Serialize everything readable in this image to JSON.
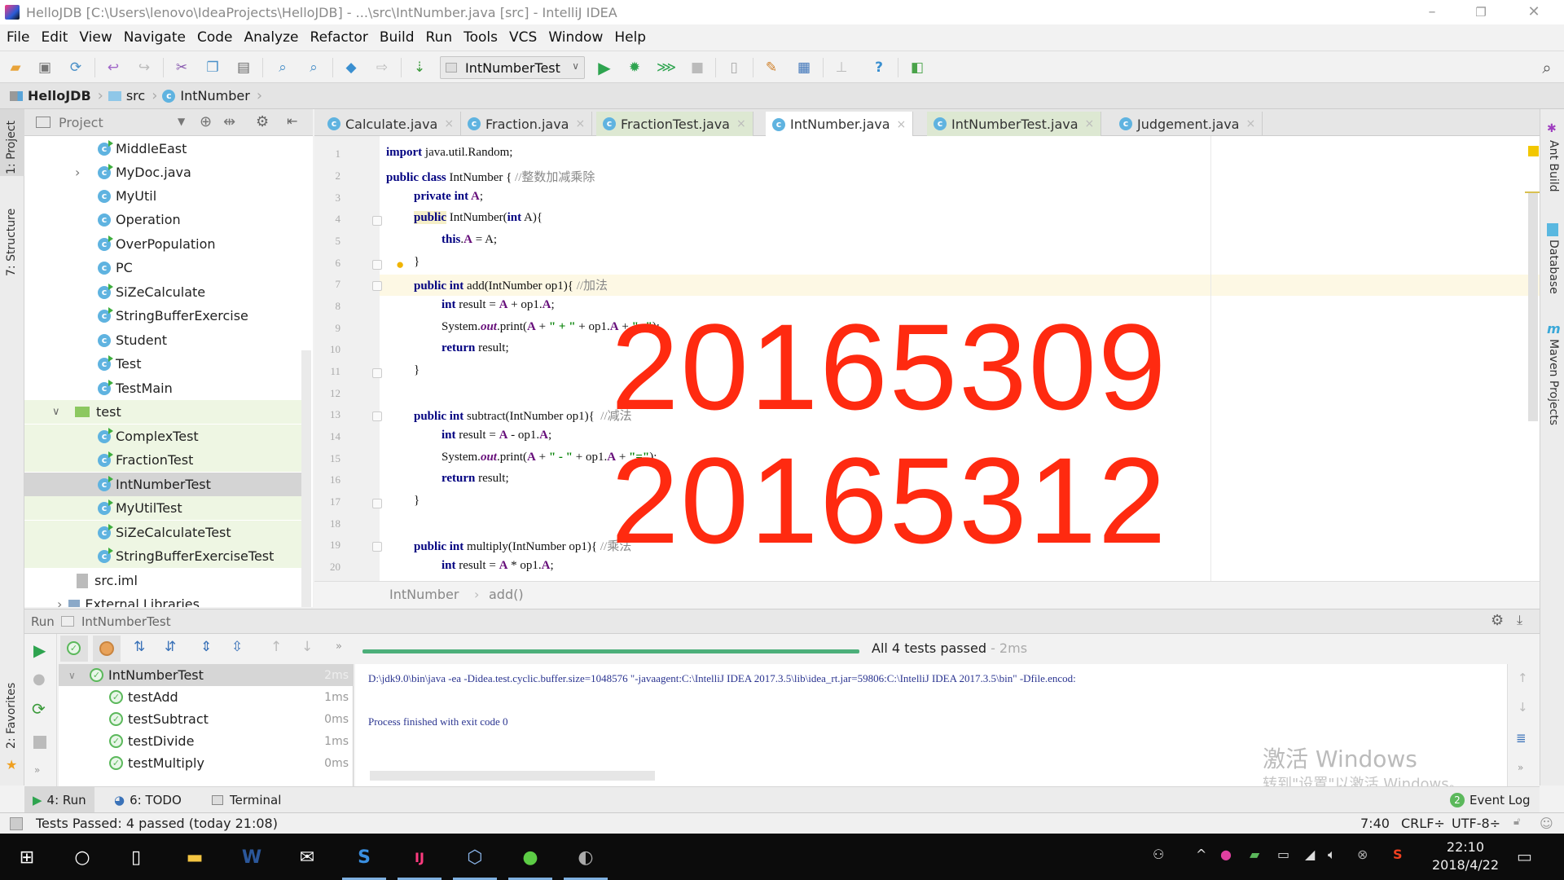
{
  "window": {
    "title": "HelloJDB [C:\\Users\\lenovo\\IdeaProjects\\HelloJDB] - ...\\src\\IntNumber.java [src] - IntelliJ IDEA",
    "controls": [
      "–",
      "❐",
      "✕"
    ]
  },
  "menu": [
    "File",
    "Edit",
    "View",
    "Navigate",
    "Code",
    "Analyze",
    "Refactor",
    "Build",
    "Run",
    "Tools",
    "VCS",
    "Window",
    "Help"
  ],
  "toolbar": {
    "run_config": "IntNumberTest",
    "icons": [
      "open-folder-icon",
      "save-icon",
      "sync-icon",
      "undo-icon",
      "redo-icon",
      "cut-icon",
      "copy-icon",
      "paste-icon",
      "find-icon",
      "replace-icon",
      "back-icon",
      "forward-icon",
      "build-icon",
      "run-icon",
      "debug-icon",
      "coverage-icon",
      "stop-icon",
      "project-structure-icon",
      "settings-icon",
      "sdk-icon",
      "vcs-icon",
      "help-icon",
      "plugin-icon",
      "search-everywhere-icon"
    ]
  },
  "navbar": {
    "crumbs": [
      "HelloJDB",
      "src",
      "IntNumber"
    ]
  },
  "left_stripe": {
    "tabs": [
      "1: Project",
      "7: Structure",
      "2: Favorites"
    ]
  },
  "right_stripe": {
    "tabs": [
      "Ant Build",
      "Database",
      "Maven Projects"
    ]
  },
  "project": {
    "header": "Project",
    "items": [
      {
        "label": "MiddleEast",
        "type": "class-runnable"
      },
      {
        "label": "MyDoc.java",
        "type": "class-runnable",
        "expandable": true
      },
      {
        "label": "MyUtil",
        "type": "class"
      },
      {
        "label": "Operation",
        "type": "class"
      },
      {
        "label": "OverPopulation",
        "type": "class-runnable"
      },
      {
        "label": "PC",
        "type": "class"
      },
      {
        "label": "SiZeCalculate",
        "type": "class-runnable"
      },
      {
        "label": "StringBufferExercise",
        "type": "class-runnable"
      },
      {
        "label": "Student",
        "type": "class"
      },
      {
        "label": "Test",
        "type": "class-runnable"
      },
      {
        "label": "TestMain",
        "type": "class-runnable"
      },
      {
        "label": "test",
        "type": "folder",
        "expanded": true
      },
      {
        "label": "ComplexTest",
        "type": "test"
      },
      {
        "label": "FractionTest",
        "type": "test"
      },
      {
        "label": "IntNumberTest",
        "type": "test",
        "selected": true
      },
      {
        "label": "MyUtilTest",
        "type": "test"
      },
      {
        "label": "SiZeCalculateTest",
        "type": "test"
      },
      {
        "label": "StringBufferExerciseTest",
        "type": "test"
      },
      {
        "label": "src.iml",
        "type": "file"
      },
      {
        "label": "External Libraries",
        "type": "library"
      }
    ]
  },
  "tabs": [
    {
      "label": "Calculate.java",
      "kind": "normal"
    },
    {
      "label": "Fraction.java",
      "kind": "normal"
    },
    {
      "label": "FractionTest.java",
      "kind": "test"
    },
    {
      "label": "IntNumber.java",
      "kind": "active"
    },
    {
      "label": "IntNumberTest.java",
      "kind": "test"
    },
    {
      "label": "Judgement.java",
      "kind": "normal"
    }
  ],
  "editor": {
    "lines": [
      "1",
      "2",
      "3",
      "4",
      "5",
      "6",
      "7",
      "8",
      "9",
      "10",
      "11",
      "12",
      "13",
      "14",
      "15",
      "16",
      "17",
      "18",
      "19",
      "20"
    ],
    "code": {
      "l1_kw": "import",
      "l1": " java.util.Random;",
      "l2_kw": "public class",
      "l2": " IntNumber { ",
      "l2_c": "//整数加减乘除",
      "l3_kw": "private int",
      "l3_f": " A",
      "l3": ";",
      "l4_kw": "public",
      "l4": " IntNumber(",
      "l4_kw2": "int",
      "l4b": " A){",
      "l5_kw": "this",
      "l5": ".",
      "l5_f": "A",
      "l5b": " = A;",
      "l6": "}",
      "l7_kw": "public int",
      "l7": " add(IntNumber op1){ ",
      "l7_c": "//加法",
      "l8_kw": "int",
      "l8": " result = ",
      "l8_f": "A",
      "l8b": " + op1.",
      "l8_f2": "A",
      "l8c": ";",
      "l9": "System.",
      "l9_f": "out",
      "l9b": ".print(",
      "l9_f2": "A",
      "l9c": " + ",
      "l9_s": "\" + \"",
      "l9d": " + op1.",
      "l9_f3": "A",
      "l9e": " + ",
      "l9_s2": "\"=\"",
      "l9f": ");",
      "l10_kw": "return",
      "l10": " result;",
      "l11": "}",
      "l13_kw": "public int",
      "l13": " subtract(IntNumber op1){  ",
      "l13_c": "//减法",
      "l14_kw": "int",
      "l14": " result = ",
      "l14_f": "A",
      "l14b": " - op1.",
      "l14_f2": "A",
      "l14c": ";",
      "l15": "System.",
      "l15_f": "out",
      "l15b": ".print(",
      "l15_f2": "A",
      "l15c": " + ",
      "l15_s": "\" - \"",
      "l15d": " + op1.",
      "l15_f3": "A",
      "l15e": " + ",
      "l15_s2": "\"=\"",
      "l15f": ");",
      "l16_kw": "return",
      "l16": " result;",
      "l17": "}",
      "l19_kw": "public int",
      "l19": " multiply(IntNumber op1){ ",
      "l19_c": "//乘法",
      "l20_kw": "int",
      "l20": " result = ",
      "l20_f": "A",
      "l20b": " * op1.",
      "l20_f2": "A",
      "l20c": ";"
    },
    "breadcrumb": [
      "IntNumber",
      "add()"
    ],
    "overlay": [
      "20165309",
      "20165312"
    ],
    "overlay_color": "#ff2a10"
  },
  "run": {
    "header_label": "Run",
    "config": "IntNumberTest",
    "progress": 1.0,
    "summary": "All 4 tests passed",
    "summary_time": "- 2ms",
    "tree": [
      {
        "label": "IntNumberTest",
        "time": "2ms",
        "root": true
      },
      {
        "label": "testAdd",
        "time": "1ms"
      },
      {
        "label": "testSubtract",
        "time": "0ms"
      },
      {
        "label": "testDivide",
        "time": "1ms"
      },
      {
        "label": "testMultiply",
        "time": "0ms"
      }
    ],
    "console": [
      "D:\\jdk9.0\\bin\\java -ea -Didea.test.cyclic.buffer.size=1048576 \"-javaagent:C:\\IntelliJ IDEA 2017.3.5\\lib\\idea_rt.jar=59806:C:\\IntelliJ IDEA 2017.3.5\\bin\" -Dfile.encod:",
      "Process finished with exit code 0"
    ]
  },
  "watermark": {
    "line1": "激活 Windows",
    "line2": "转到\"设置\"以激活 Windows。"
  },
  "bottom_tabs": [
    {
      "label": "4: Run",
      "active": true
    },
    {
      "label": "6: TODO"
    },
    {
      "label": "Terminal"
    }
  ],
  "event_log": {
    "label": "Event Log",
    "count": "2"
  },
  "status": {
    "message": "Tests Passed: 4 passed (today 21:08)",
    "position": "7:40",
    "line_sep": "CRLF÷",
    "encoding": "UTF-8÷"
  },
  "taskbar": {
    "time": "22:10",
    "date": "2018/4/22",
    "apps": [
      "start",
      "cortana",
      "task-view",
      "file-explorer",
      "word",
      "mail",
      "sogou",
      "intellij",
      "virtualbox",
      "wechat",
      "app"
    ]
  },
  "colors": {
    "progress": "#4caf7a",
    "test_ok": "#5bb85b",
    "keyword": "#000080",
    "field": "#660e7a"
  }
}
